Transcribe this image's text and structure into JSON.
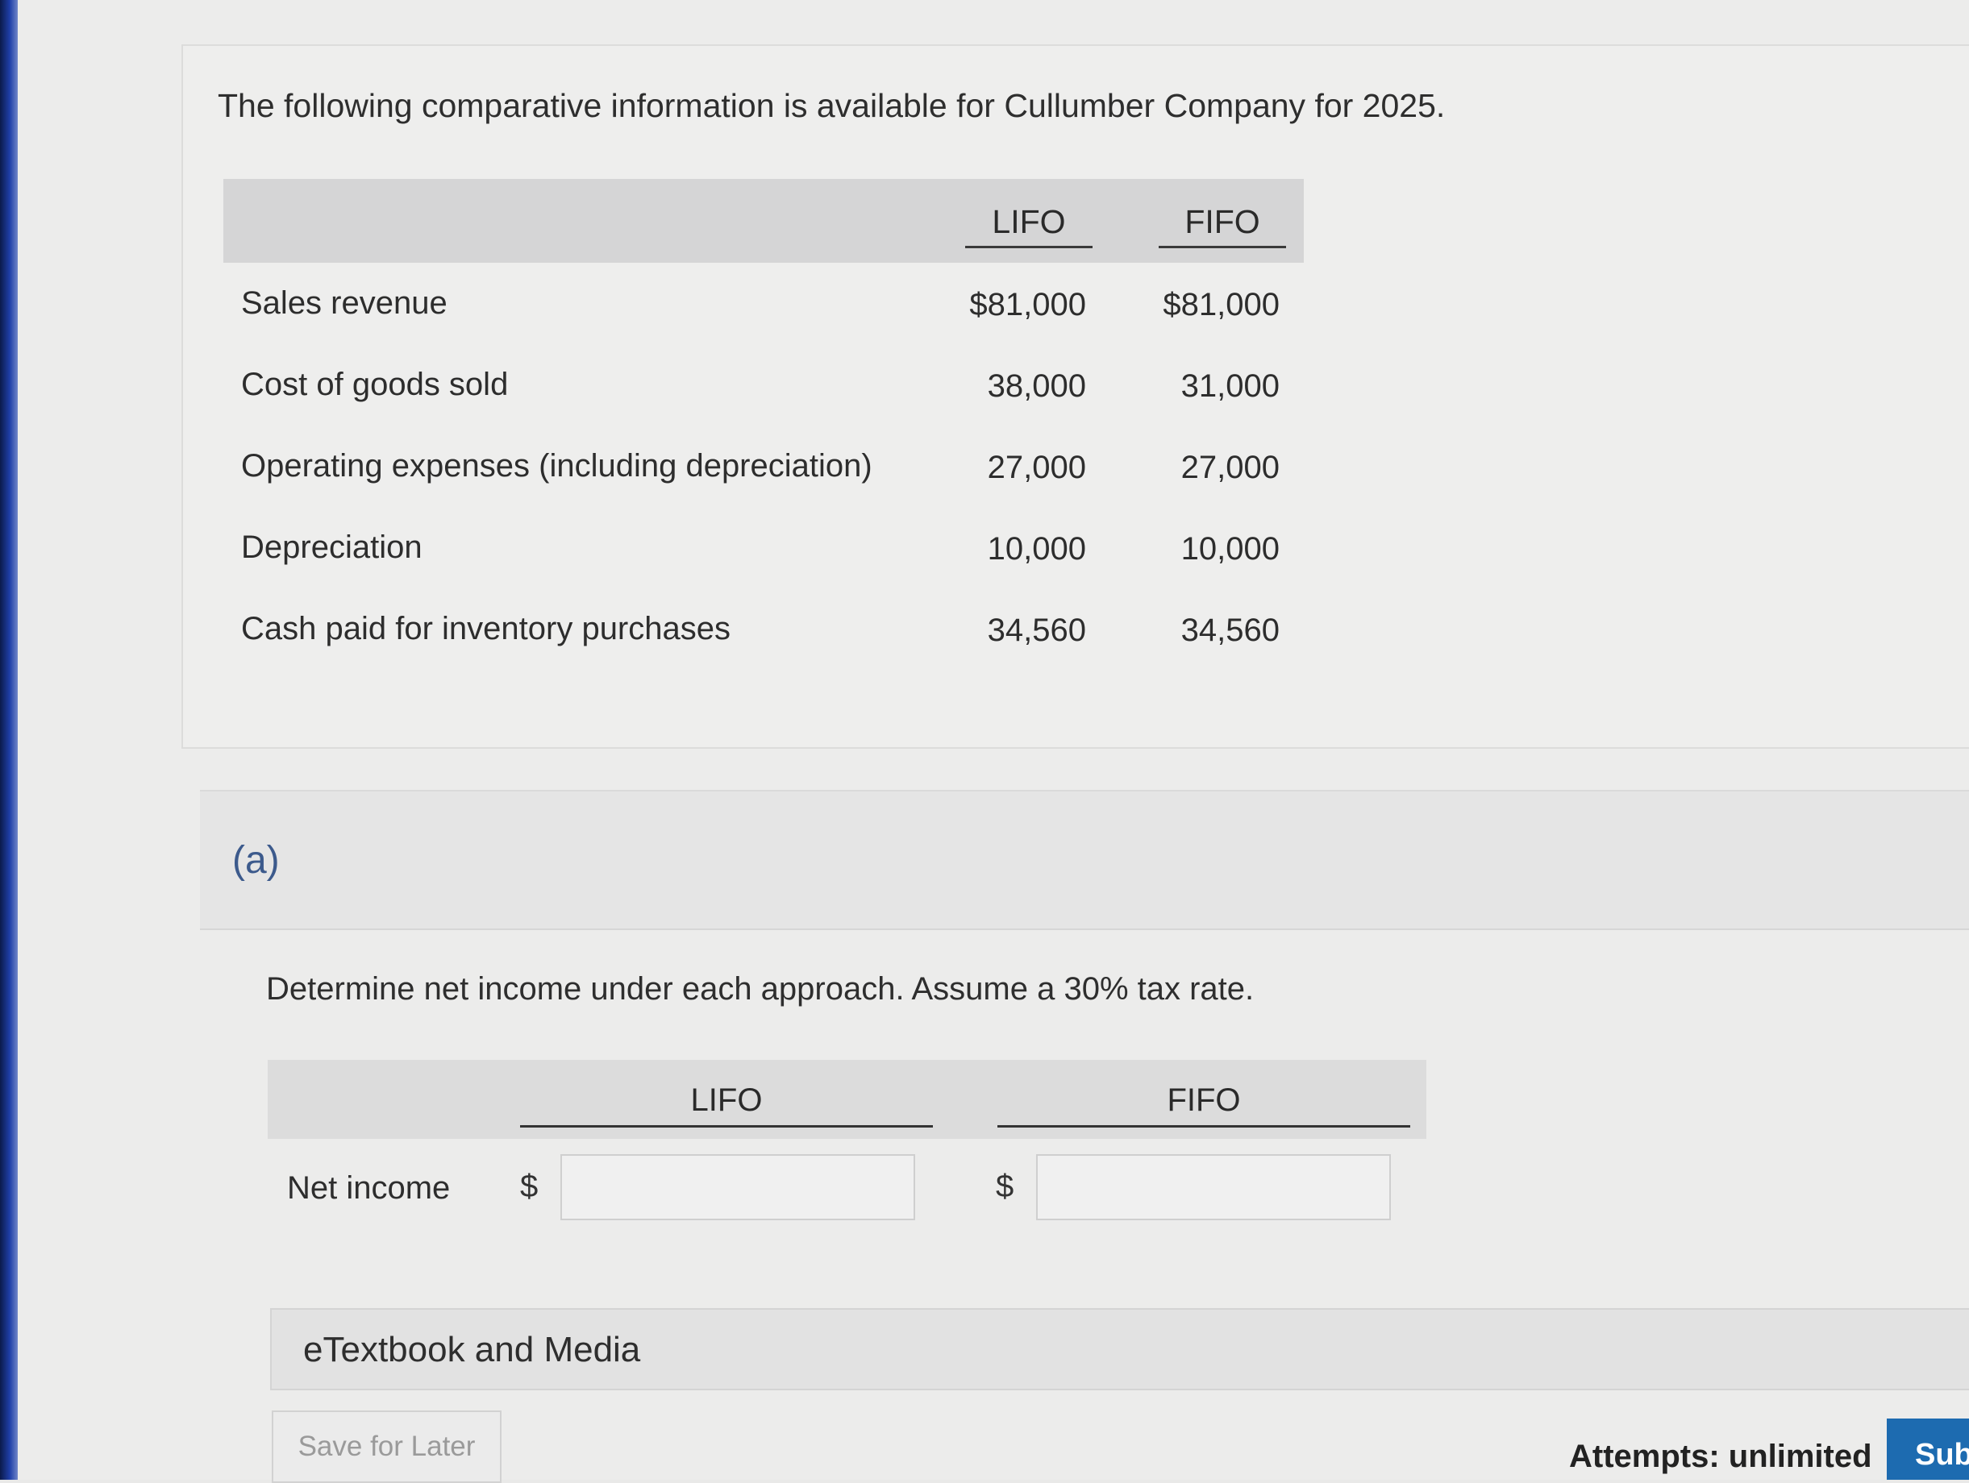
{
  "intro_text": "The following comparative information is available for Cullumber Company for 2025.",
  "info_table": {
    "headers": [
      "LIFO",
      "FIFO"
    ],
    "rows": [
      {
        "label": "Sales revenue",
        "lifo": "$81,000",
        "fifo": "$81,000"
      },
      {
        "label": "Cost of goods sold",
        "lifo": "38,000",
        "fifo": "31,000"
      },
      {
        "label": "Operating expenses (including depreciation)",
        "lifo": "27,000",
        "fifo": "27,000"
      },
      {
        "label": "Depreciation",
        "lifo": "10,000",
        "fifo": "10,000"
      },
      {
        "label": "Cash paid for inventory purchases",
        "lifo": "34,560",
        "fifo": "34,560"
      }
    ]
  },
  "part": {
    "label": "(a)",
    "question": "Determine net income under each approach. Assume a 30% tax rate.",
    "answer_table": {
      "headers": [
        "LIFO",
        "FIFO"
      ],
      "row_label": "Net income",
      "currency": "$",
      "lifo_value": "",
      "fifo_value": ""
    }
  },
  "media_label": "eTextbook and Media",
  "buttons": {
    "save": "Save for Later",
    "submit": "Submit"
  },
  "attempts": "Attempts: unlimited"
}
